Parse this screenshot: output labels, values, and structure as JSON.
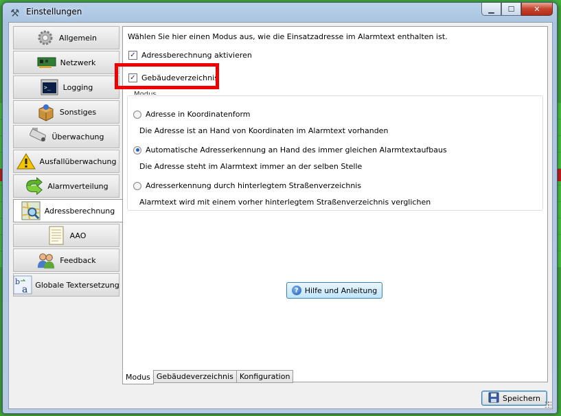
{
  "window": {
    "title": "Einstellungen"
  },
  "sidebar": {
    "items": [
      {
        "label": "Allgemein",
        "icon": "gear-icon",
        "active": false
      },
      {
        "label": "Netzwerk",
        "icon": "network-card-icon",
        "active": false
      },
      {
        "label": "Logging",
        "icon": "console-icon",
        "active": false
      },
      {
        "label": "Sonstiges",
        "icon": "package-icon",
        "active": false
      },
      {
        "label": "Überwachung",
        "icon": "camera-icon",
        "active": false
      },
      {
        "label": "Ausfallüberwachung",
        "icon": "warning-icon",
        "active": false
      },
      {
        "label": "Alarmverteilung",
        "icon": "arrows-icon",
        "active": false
      },
      {
        "label": "Adressberechnung",
        "icon": "map-search-icon",
        "active": true
      },
      {
        "label": "AAO",
        "icon": "document-icon",
        "active": false
      },
      {
        "label": "Feedback",
        "icon": "users-icon",
        "active": false
      },
      {
        "label": "Globale Textersetzung",
        "icon": "text-replace-icon",
        "active": false
      }
    ]
  },
  "content": {
    "intro": "Wählen Sie hier einen Modus aus, wie die Einsatzadresse im Alarmtext enthalten ist.",
    "checkboxes": [
      {
        "label": "Adressberechnung aktivieren",
        "checked": true
      },
      {
        "label": "Gebäudeverzeichnis",
        "checked": true
      }
    ],
    "group_label": "Modus",
    "options": [
      {
        "label": "Adresse in Koordinatenform",
        "desc": "Die Adresse ist an Hand von Koordinaten im Alarmtext vorhanden",
        "selected": false
      },
      {
        "label": "Automatische Adresserkennung an Hand des immer gleichen Alarmtextaufbaus",
        "desc": "Die Adresse steht im Alarmtext immer an der selben Stelle",
        "selected": true
      },
      {
        "label": "Adresserkennung durch hinterlegtem Straßenverzeichnis",
        "desc": "Alarmtext wird mit einem vorher hinterlegtem Straßenverzeichnis verglichen",
        "selected": false
      }
    ],
    "help_button": "Hilfe und Anleitung"
  },
  "tabs": [
    "Modus",
    "Gebäudeverzeichnis",
    "Konfiguration"
  ],
  "save_button": "Speichern",
  "colors": {
    "highlight": "#f00000",
    "accent": "#3c7fb1"
  }
}
